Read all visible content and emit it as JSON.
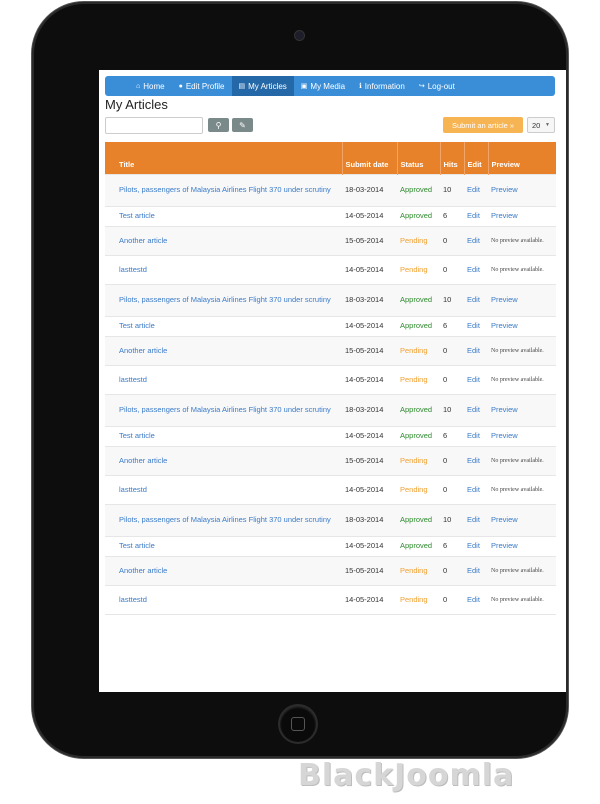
{
  "nav": {
    "items": [
      {
        "label": "Home",
        "icon": "home-icon",
        "glyph": "⌂"
      },
      {
        "label": "Edit Profile",
        "icon": "user-icon",
        "glyph": "●"
      },
      {
        "label": "My Articles",
        "icon": "file-icon",
        "glyph": "▤"
      },
      {
        "label": "My Media",
        "icon": "image-icon",
        "glyph": "▣"
      },
      {
        "label": "Information",
        "icon": "info-icon",
        "glyph": "ℹ"
      },
      {
        "label": "Log-out",
        "icon": "logout-icon",
        "glyph": "↪"
      }
    ],
    "active_index": 2
  },
  "page": {
    "title": "My Articles"
  },
  "toolbar": {
    "search_value": "",
    "search_icon": "⚲",
    "clear_icon": "✎",
    "submit_label": "Submit an article »",
    "limit_value": "20"
  },
  "table": {
    "headers": {
      "title": "Title",
      "date": "Submit date",
      "status": "Status",
      "hits": "Hits",
      "edit": "Edit",
      "preview": "Preview"
    },
    "rows": [
      {
        "title": "Pilots, passengers of Malaysia Airlines Flight 370 under scrutiny",
        "date": "18-03-2014",
        "status": "Approved",
        "hits": "10",
        "edit": "Edit",
        "preview": "Preview"
      },
      {
        "title": "Test article",
        "date": "14-05-2014",
        "status": "Approved",
        "hits": "6",
        "edit": "Edit",
        "preview": "Preview"
      },
      {
        "title": "Another article",
        "date": "15-05-2014",
        "status": "Pending",
        "hits": "0",
        "edit": "Edit",
        "preview": "No preview available."
      },
      {
        "title": "lasttestd",
        "date": "14-05-2014",
        "status": "Pending",
        "hits": "0",
        "edit": "Edit",
        "preview": "No preview available."
      },
      {
        "title": "Pilots, passengers of Malaysia Airlines Flight 370 under scrutiny",
        "date": "18-03-2014",
        "status": "Approved",
        "hits": "10",
        "edit": "Edit",
        "preview": "Preview"
      },
      {
        "title": "Test article",
        "date": "14-05-2014",
        "status": "Approved",
        "hits": "6",
        "edit": "Edit",
        "preview": "Preview"
      },
      {
        "title": "Another article",
        "date": "15-05-2014",
        "status": "Pending",
        "hits": "0",
        "edit": "Edit",
        "preview": "No preview available."
      },
      {
        "title": "lasttestd",
        "date": "14-05-2014",
        "status": "Pending",
        "hits": "0",
        "edit": "Edit",
        "preview": "No preview available."
      },
      {
        "title": "Pilots, passengers of Malaysia Airlines Flight 370 under scrutiny",
        "date": "18-03-2014",
        "status": "Approved",
        "hits": "10",
        "edit": "Edit",
        "preview": "Preview"
      },
      {
        "title": "Test article",
        "date": "14-05-2014",
        "status": "Approved",
        "hits": "6",
        "edit": "Edit",
        "preview": "Preview"
      },
      {
        "title": "Another article",
        "date": "15-05-2014",
        "status": "Pending",
        "hits": "0",
        "edit": "Edit",
        "preview": "No preview available."
      },
      {
        "title": "lasttestd",
        "date": "14-05-2014",
        "status": "Pending",
        "hits": "0",
        "edit": "Edit",
        "preview": "No preview available."
      },
      {
        "title": "Pilots, passengers of Malaysia Airlines Flight 370 under scrutiny",
        "date": "18-03-2014",
        "status": "Approved",
        "hits": "10",
        "edit": "Edit",
        "preview": "Preview"
      },
      {
        "title": "Test article",
        "date": "14-05-2014",
        "status": "Approved",
        "hits": "6",
        "edit": "Edit",
        "preview": "Preview"
      },
      {
        "title": "Another article",
        "date": "15-05-2014",
        "status": "Pending",
        "hits": "0",
        "edit": "Edit",
        "preview": "No preview available."
      },
      {
        "title": "lasttestd",
        "date": "14-05-2014",
        "status": "Pending",
        "hits": "0",
        "edit": "Edit",
        "preview": "No preview available."
      }
    ]
  },
  "colors": {
    "nav_bg": "#3a8ed8",
    "nav_active": "#2468a8",
    "table_header": "#e8822a",
    "submit_button": "#f7b453",
    "approved": "#2e8b2e",
    "pending": "#f0a030",
    "link": "#3a7bc8"
  },
  "watermark": "BlackJoomla"
}
